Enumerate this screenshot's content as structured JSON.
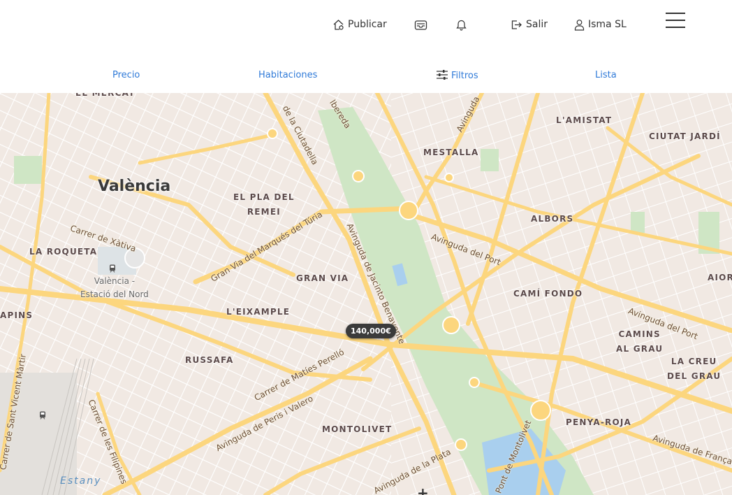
{
  "header": {
    "publish_label": "Publicar",
    "logout_label": "Salir",
    "user_label": "Isma SL"
  },
  "filters": {
    "price_label": "Precio",
    "rooms_label": "Habitaciones",
    "filters_label": "Filtros",
    "list_label": "Lista"
  },
  "map": {
    "city_label": "València",
    "neighborhoods": {
      "el_mercat": "EL MERCAT",
      "lamistat": "L'AMISTAT",
      "ciutat_jardi": "CIUTAT JARDÍ",
      "mestalla": "MESTALLA",
      "el_pla_del_remei_1": "EL PLA DEL",
      "el_pla_del_remei_2": "REMEI",
      "albors": "ALBORS",
      "la_roqueta": "LA ROQUETA",
      "gran_via": "GRAN VIA",
      "cami_fondo": "CAMÍ FONDO",
      "aior": "AIOR",
      "leixample": "L'EIXAMPLE",
      "apins": "APINS",
      "camins_al_grau_1": "CAMINS",
      "camins_al_grau_2": "AL GRAU",
      "russafa": "RUSSAFA",
      "la_creu_del_grau_1": "LA CREU",
      "la_creu_del_grau_2": "DEL GRAU",
      "penya_roja": "PENYA-ROJA",
      "montolivet": "MONTOLIVET"
    },
    "streets": {
      "ciutadella": "de la Ciutadella",
      "albereda": "lbereda",
      "avinguda_top": "Avinguda",
      "xativa": "Carrer de Xàtiva",
      "marques_turia": "Gran Via del Marqués del Túria",
      "jacinto_benavente": "Avinguda de Jacinto Benavente",
      "avinguda_del_port_1": "Avinguda del Port",
      "avinguda_del_port_2": "Avinguda del Port",
      "maties_perello": "Carrer de Matíes Perelló",
      "peris_valero": "Avinguda de Peris i Valero",
      "sant_vicent": "Carrer de Sant Vicent Màrtir",
      "filipines": "Carrer de les Filipines",
      "la_plata": "Avinguda de la Plata",
      "pont_montolivet": "Pont de Montolivet",
      "avinguda_franca": "Avinguda de França"
    },
    "station_line1": "València -",
    "station_line2": "Estació del Nord",
    "water_label": "Estany",
    "price_marker": "140,000€",
    "zoom_in": "+"
  },
  "colors": {
    "accent": "#2f7ad8",
    "map_background": "#f2ece6",
    "major_road": "#fcd67e",
    "park": "#cfe6c5",
    "water": "#a9cfee"
  }
}
